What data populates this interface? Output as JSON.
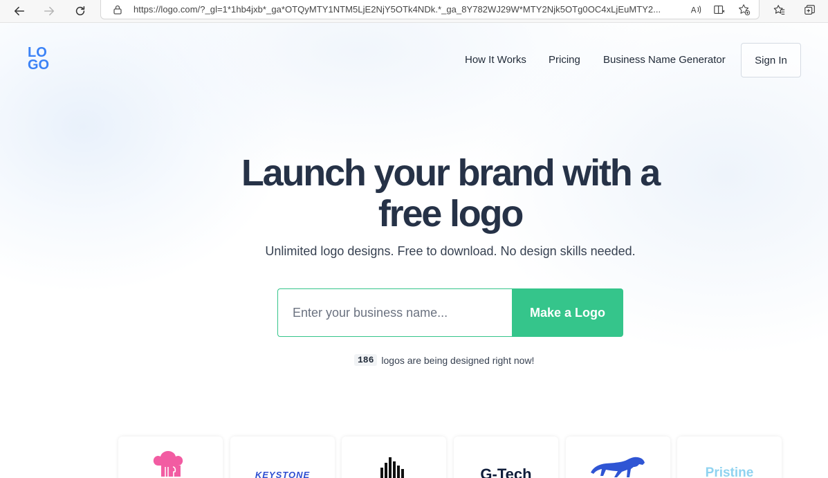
{
  "browser": {
    "url": "https://logo.com/?_gl=1*1hb4jxb*_ga*OTQyMTY1NTM5LjE2NjY5OTk4NDk.*_ga_8Y782WJ29W*MTY2Njk5OTg0OC4xLjEuMTY2..."
  },
  "header": {
    "logo_top": "LO",
    "logo_bottom": "GO",
    "nav": [
      "How It Works",
      "Pricing",
      "Business Name Generator"
    ],
    "signin_label": "Sign In"
  },
  "hero": {
    "title_line1": "Launch your brand with a",
    "title_line2": "free logo",
    "subtitle": "Unlimited logo designs. Free to download. No design skills needed.",
    "input_placeholder": "Enter your business name...",
    "button_label": "Make a Logo",
    "counter_value": "186",
    "counter_text": "logos are being designed right now!"
  },
  "examples": {
    "cards": [
      {
        "icon": "chef-hat-icon",
        "text": "",
        "color": "#f25ca2"
      },
      {
        "icon": "text-logo",
        "text": "KEYSTONE",
        "color": "#2f4fd1"
      },
      {
        "icon": "city-skyline-icon",
        "text": "",
        "color": "#111111"
      },
      {
        "icon": "text-logo",
        "text": "G-Tech",
        "color": "#0f1d3a"
      },
      {
        "icon": "panther-icon",
        "text": "",
        "color": "#2f55d4"
      },
      {
        "icon": "text-logo",
        "text": "Pristine",
        "color": "#8fd3f0"
      }
    ]
  },
  "colors": {
    "accent": "#35c58b",
    "brand": "#3b82f6",
    "title": "#263247"
  }
}
